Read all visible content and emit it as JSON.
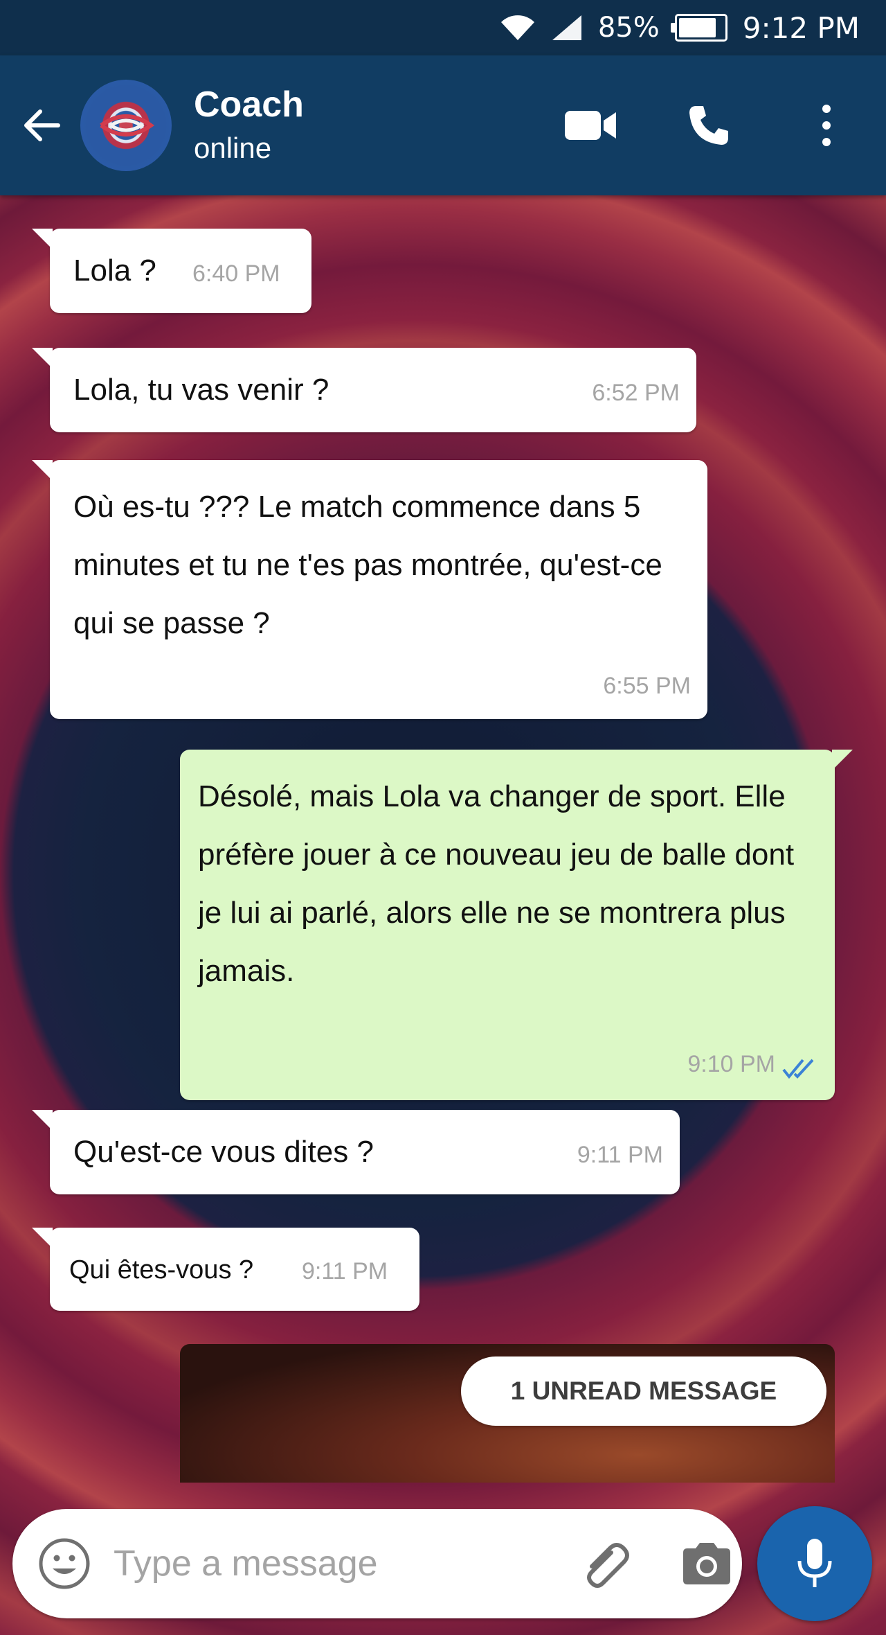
{
  "status_bar": {
    "battery_percent": "85%",
    "battery_level": 0.85,
    "time": "9:12 PM",
    "icons": [
      "wifi-icon",
      "signal-icon",
      "battery-icon"
    ]
  },
  "header": {
    "contact_name": "Coach",
    "contact_status": "online",
    "icons": [
      "back-arrow-icon",
      "video-call-icon",
      "phone-icon",
      "more-options-icon"
    ]
  },
  "messages": [
    {
      "direction": "incoming",
      "text": "Lola ?",
      "time": "6:40 PM"
    },
    {
      "direction": "incoming",
      "text": "Lola, tu vas venir ?",
      "time": "6:52 PM"
    },
    {
      "direction": "incoming",
      "text": "Où es-tu ??? Le match commence dans 5 minutes et tu ne t'es pas montrée, qu'est-ce qui se passe ?",
      "time": "6:55 PM"
    },
    {
      "direction": "outgoing",
      "text": "Désolé, mais Lola va changer de sport. Elle préfère jouer à ce nouveau jeu de balle dont je lui ai parlé, alors elle ne se montrera plus jamais.",
      "time": "9:10 PM",
      "status": "read"
    },
    {
      "direction": "incoming",
      "text": "Qu'est-ce vous dites ?",
      "time": "9:11 PM"
    },
    {
      "direction": "incoming",
      "text": "Qui êtes-vous ?",
      "time": "9:11 PM"
    }
  ],
  "unread_badge": "1 UNREAD MESSAGE",
  "composer": {
    "placeholder": "Type a message",
    "icons": [
      "emoji-icon",
      "attach-icon",
      "camera-icon",
      "mic-icon"
    ]
  },
  "colors": {
    "header": "#113d63",
    "status_bar": "#0f2f4c",
    "outgoing_bubble": "#dcf8c6",
    "incoming_bubble": "#ffffff",
    "read_ticks": "#3b82d6",
    "mic_button": "#1a64ad"
  }
}
